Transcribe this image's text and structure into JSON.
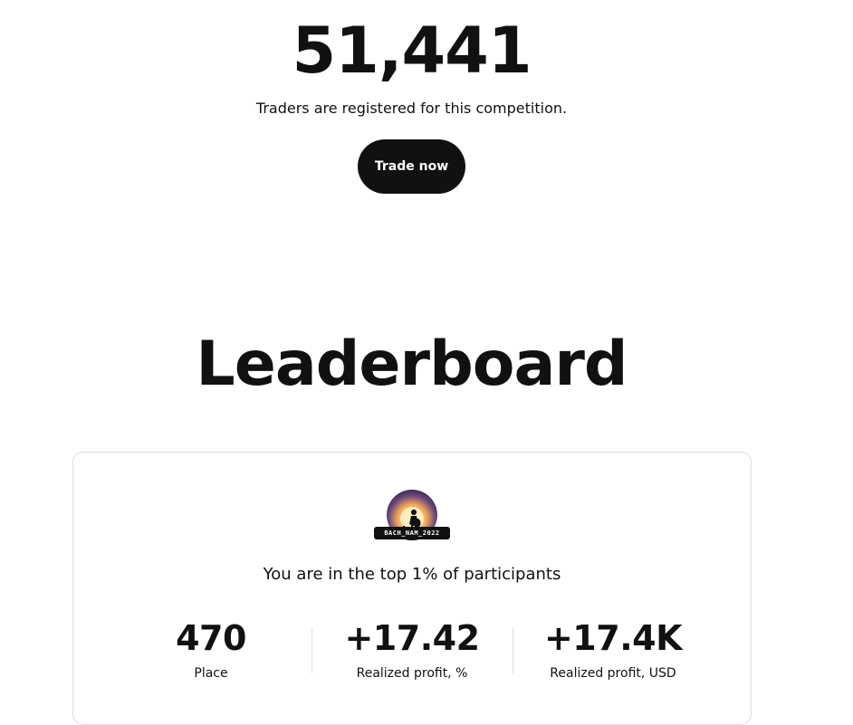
{
  "hero": {
    "count": "51,441",
    "subtitle": "Traders are registered for this competition.",
    "trade_button": "Trade now"
  },
  "leaderboard": {
    "title": "Leaderboard",
    "user": {
      "avatar_icon": "user-avatar-icon",
      "username": "BACH_NAM_2022",
      "rank_text": "You are in the top 1% of participants"
    },
    "stats": [
      {
        "value": "470",
        "label": "Place"
      },
      {
        "value": "+17.42",
        "label": "Realized profit, %"
      },
      {
        "value": "+17.4K",
        "label": "Realized profit, USD"
      }
    ]
  },
  "colors": {
    "text": "#111111",
    "button_bg": "#111111",
    "button_text": "#ffffff",
    "card_border": "#dedede",
    "background": "#ffffff"
  }
}
